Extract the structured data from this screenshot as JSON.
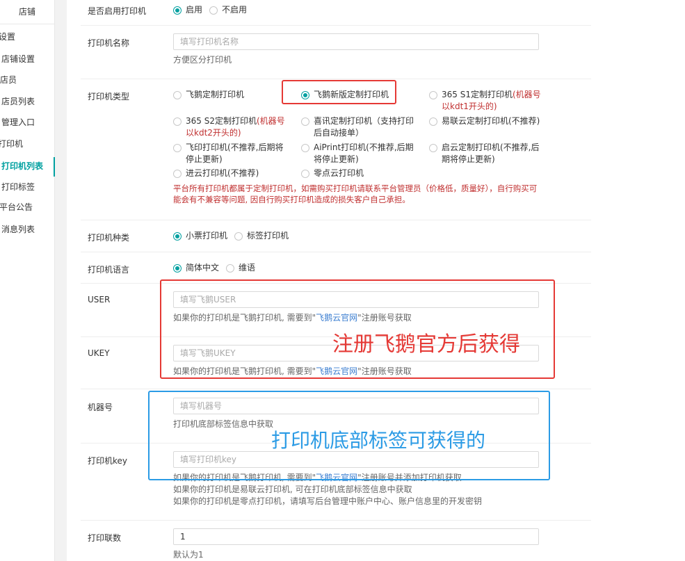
{
  "sidebar": {
    "title": "店铺",
    "items": [
      {
        "label": "设置"
      },
      {
        "label": "店铺设置"
      },
      {
        "label": "店员"
      },
      {
        "label": "店员列表"
      },
      {
        "label": "管理入口"
      },
      {
        "label": "打印机"
      },
      {
        "label": "打印机列表"
      },
      {
        "label": "打印标签"
      },
      {
        "label": "平台公告"
      },
      {
        "label": "消息列表"
      }
    ]
  },
  "form": {
    "enable": {
      "label": "是否启用打印机",
      "options": [
        "启用",
        "不启用"
      ],
      "selected": "启用"
    },
    "name": {
      "label": "打印机名称",
      "placeholder": "填写打印机名称",
      "help": "方便区分打印机"
    },
    "type": {
      "label": "打印机类型",
      "options": [
        {
          "text": "飞鹅定制打印机",
          "extra": ""
        },
        {
          "text": "飞鹅新版定制打印机",
          "extra": ""
        },
        {
          "text": "365 S1定制打印机",
          "extra": "(机器号以kdt1开头的)"
        },
        {
          "text": "365 S2定制打印机",
          "extra": "(机器号以kdt2开头的)"
        },
        {
          "text": "喜讯定制打印机（支持打印后自动接单）",
          "extra": ""
        },
        {
          "text": "易联云定制打印机(不推荐)",
          "extra": ""
        },
        {
          "text": "飞印打印机(不推荐,后期将停止更新)",
          "extra": ""
        },
        {
          "text": "AiPrint打印机(不推荐,后期将停止更新)",
          "extra": ""
        },
        {
          "text": "启云定制打印机(不推荐,后期将停止更新)",
          "extra": ""
        },
        {
          "text": "进云打印机(不推荐)",
          "extra": ""
        },
        {
          "text": "零点云打印机",
          "extra": ""
        }
      ],
      "selected": "飞鹅新版定制打印机",
      "warning": "平台所有打印机都属于定制打印机，如需购买打印机请联系平台管理员（价格低，质量好），自行购买可能会有不兼容等问题, 因自行购买打印机造成的损失客户自己承担。"
    },
    "kind": {
      "label": "打印机种类",
      "options": [
        "小票打印机",
        "标签打印机"
      ],
      "selected": "小票打印机"
    },
    "language": {
      "label": "打印机语言",
      "options": [
        "简体中文",
        "维语"
      ],
      "selected": "简体中文"
    },
    "user": {
      "label": "USER",
      "placeholder": "填写飞鹅USER",
      "help_pre": "如果你的打印机是飞鹅打印机, 需要到\"",
      "help_link": "飞鹅云官网",
      "help_post": "\"注册账号获取"
    },
    "ukey": {
      "label": "UKEY",
      "placeholder": "填写飞鹅UKEY",
      "help_pre": "如果你的打印机是飞鹅打印机, 需要到\"",
      "help_link": "飞鹅云官网",
      "help_post": "\"注册账号获取"
    },
    "sn": {
      "label": "机器号",
      "placeholder": "填写机器号",
      "help": "打印机底部标签信息中获取"
    },
    "key": {
      "label": "打印机key",
      "placeholder": "填写打印机key",
      "help1_pre": "如果你的打印机是飞鹅打印机, 需要到\"",
      "help1_link": "飞鹅云官网",
      "help1_post": "\"注册账号并添加打印机获取",
      "help2": "如果你的打印机是易联云打印机, 可在打印机底部标签信息中获取",
      "help3": "如果你的打印机是零点打印机，请填写后台管理中账户中心、账户信息里的开发密钥"
    },
    "copies": {
      "label": "打印联数",
      "value": "1",
      "help": "默认为1"
    }
  },
  "annotations": {
    "red_text": "注册飞鹅官方后获得",
    "blue_text": "打印机底部标签可获得的"
  },
  "colors": {
    "accent": "#00a0a0",
    "annotation_red": "#e53935",
    "annotation_blue": "#2b9be5",
    "warning": "#c03030",
    "link": "#3d7fd1"
  }
}
